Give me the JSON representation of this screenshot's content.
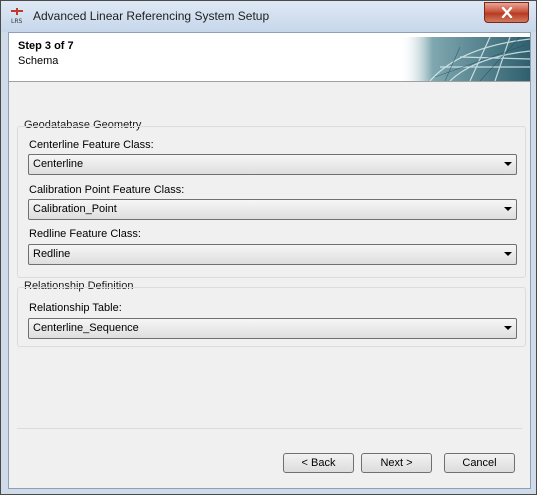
{
  "window": {
    "title": "Advanced Linear Referencing System Setup",
    "icon": "lrs-app-icon",
    "icon_text": "LRS"
  },
  "header": {
    "step": "Step 3 of 7",
    "subtitle": "Schema"
  },
  "groups": {
    "geometry": {
      "title": "Geodatabase Geometry",
      "fields": [
        {
          "label": "Centerline Feature Class:",
          "value": "Centerline"
        },
        {
          "label": "Calibration Point Feature Class:",
          "value": "Calibration_Point"
        },
        {
          "label": "Redline Feature Class:",
          "value": "Redline"
        }
      ]
    },
    "relationship": {
      "title": "Relationship Definition",
      "fields": [
        {
          "label": "Relationship Table:",
          "value": "Centerline_Sequence"
        }
      ]
    }
  },
  "buttons": {
    "back": "< Back",
    "next": "Next >",
    "cancel": "Cancel"
  },
  "colors": {
    "close": "#c9553d",
    "accent": "#3a7a8a"
  }
}
